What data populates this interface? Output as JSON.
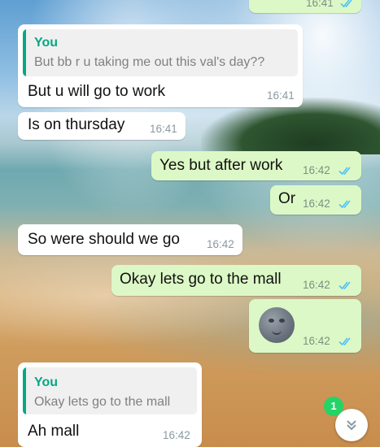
{
  "chat": {
    "top_partial": {
      "time": "16:41"
    },
    "messages": [
      {
        "reply_name": "You",
        "reply_text": "But bb r u taking me out this val's day??",
        "text": "But u will go to work",
        "time": "16:41"
      },
      {
        "text": "Is on thursday",
        "time": "16:41"
      },
      {
        "text": "Yes but after work",
        "time": "16:42"
      },
      {
        "text": "Or",
        "time": "16:42"
      },
      {
        "text": "So were should we go",
        "time": "16:42"
      },
      {
        "text": "Okay lets go to the mall",
        "time": "16:42"
      },
      {
        "emoji": "new-moon-face",
        "time": "16:42"
      },
      {
        "reply_name": "You",
        "reply_text": "Okay lets go to the mall",
        "text": "Ah mall",
        "time": "16:42"
      }
    ]
  },
  "scroll_button": {
    "unread_count": "1",
    "icon": "double-chevron-down-icon"
  },
  "colors": {
    "incoming": "#ffffff",
    "outgoing": "#dcf8c6",
    "read_ticks": "#4fc3f7",
    "quote_accent": "#06a884",
    "badge": "#25d366"
  }
}
